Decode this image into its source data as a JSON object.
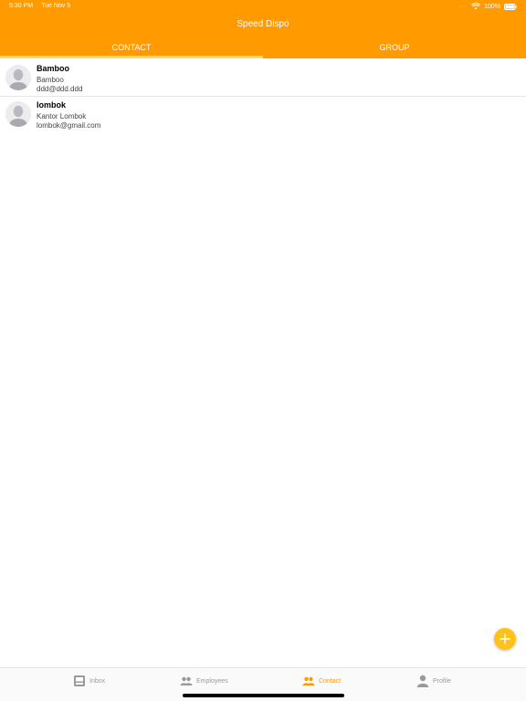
{
  "status_bar": {
    "time": "5:30 PM",
    "date": "Tue Nov 5",
    "battery": "100%"
  },
  "header": {
    "title": "Speed Dispo"
  },
  "tabs": [
    {
      "label": "CONTACT",
      "active": true
    },
    {
      "label": "GROUP",
      "active": false
    }
  ],
  "contacts": [
    {
      "name": "Bamboo",
      "company": "Bamboo",
      "email": "ddd@ddd.ddd"
    },
    {
      "name": "lombok",
      "company": "Kantor Lombok",
      "email": "lombok@gmail.com"
    }
  ],
  "fab": {
    "icon": "plus-icon"
  },
  "bottom_nav": [
    {
      "label": "Inbox",
      "icon": "inbox-icon",
      "active": false
    },
    {
      "label": "Employees",
      "icon": "people-icon",
      "active": false
    },
    {
      "label": "Contact",
      "icon": "people-icon",
      "active": true
    },
    {
      "label": "Profile",
      "icon": "person-icon",
      "active": false
    }
  ],
  "colors": {
    "accent": "#ff9a00",
    "tab_indicator": "#ffd86e",
    "fab": "#ffc21a",
    "inactive": "#9a9a9a"
  }
}
